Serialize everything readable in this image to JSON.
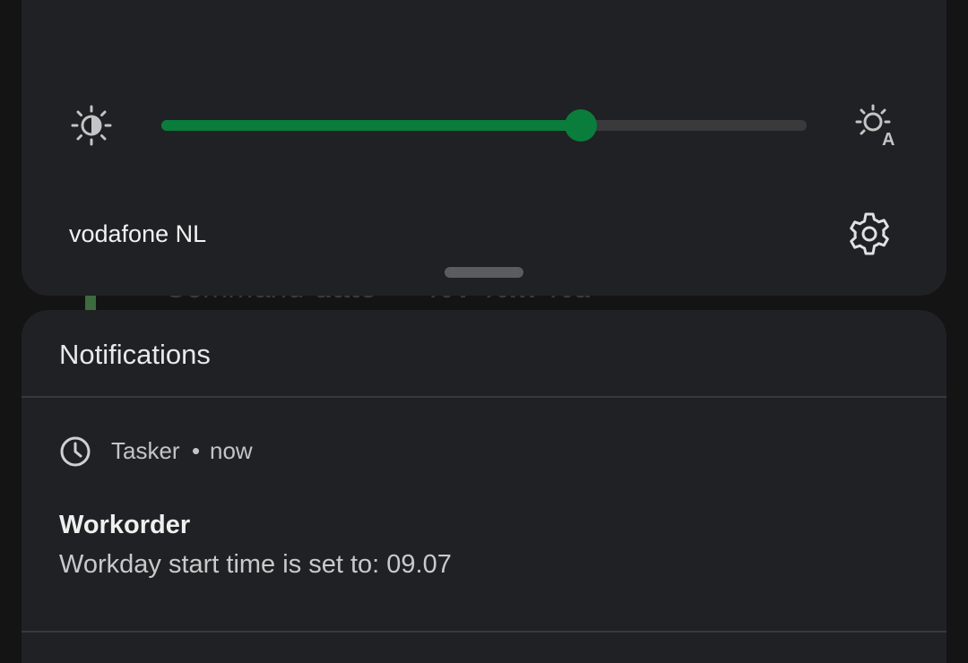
{
  "background_app": {
    "command_label": "Command",
    "command_value": "date + \"%Y-%m-%d\""
  },
  "quick_settings": {
    "tiles": [
      {
        "state": "on",
        "icon": "tile-icon"
      },
      {
        "state": "off",
        "icon": "tile-icon"
      },
      {
        "state": "on",
        "icon": "tile-icon"
      },
      {
        "state": "on",
        "icon": "tile-icon"
      },
      {
        "state": "off",
        "icon": "tile-icon"
      },
      {
        "state": "on",
        "icon": "tile-icon"
      }
    ],
    "brightness_level": 0.65,
    "carrier": "vodafone NL",
    "colors": {
      "accent": "#0a7d3c",
      "panel": "#202124"
    }
  },
  "notifications": {
    "header": "Notifications",
    "items": [
      {
        "app": "Tasker",
        "separator": "•",
        "time": "now",
        "title": "Workorder",
        "text": "Workday start time is set to: 09.07"
      }
    ]
  }
}
